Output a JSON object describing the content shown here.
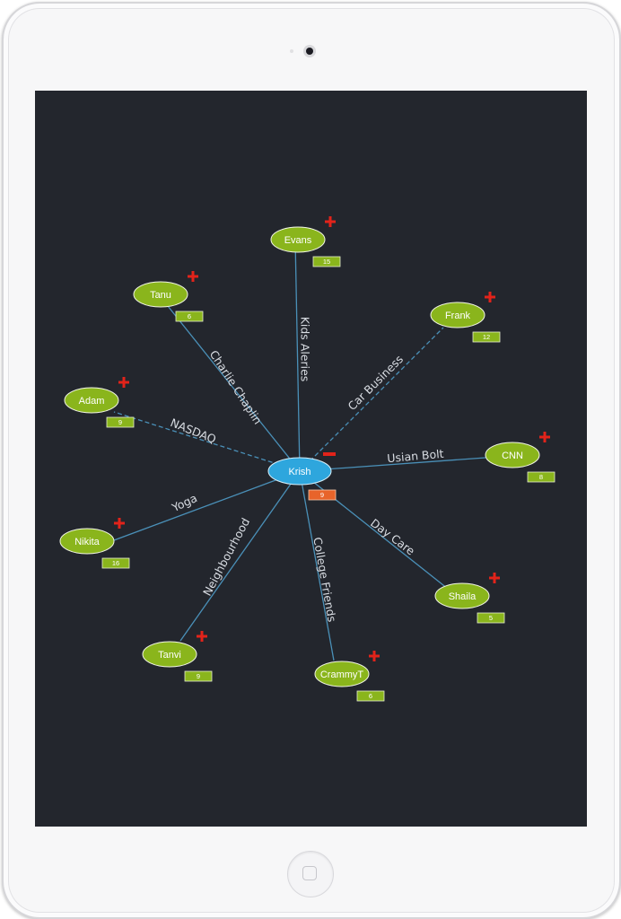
{
  "colors": {
    "background": "#23262d",
    "leaf_node": "#8ab51c",
    "center_node": "#2ea6dd",
    "edge": "#4a90b8",
    "badge": "#8ab51c",
    "center_badge": "#e8642a",
    "expand_icon": "#e2231a"
  },
  "graph": {
    "center": {
      "name": "Krish",
      "count": "9",
      "icon": "minus-icon"
    },
    "nodes": [
      {
        "name": "Evans",
        "count": "15",
        "edge_label": "Kids Aleries",
        "edge_style": "solid",
        "icon": "plus-icon"
      },
      {
        "name": "Tanu",
        "count": "6",
        "edge_label": "Charlie Chaplin",
        "edge_style": "solid",
        "icon": "plus-icon"
      },
      {
        "name": "Frank",
        "count": "12",
        "edge_label": "Car Business",
        "edge_style": "dashed",
        "icon": "plus-icon"
      },
      {
        "name": "Adam",
        "count": "9",
        "edge_label": "NASDAQ",
        "edge_style": "dashed",
        "icon": "plus-icon"
      },
      {
        "name": "CNN",
        "count": "8",
        "edge_label": "Usian Bolt",
        "edge_style": "solid",
        "icon": "plus-icon"
      },
      {
        "name": "Nikita",
        "count": "16",
        "edge_label": "Yoga",
        "edge_style": "solid",
        "icon": "plus-icon"
      },
      {
        "name": "Shaila",
        "count": "5",
        "edge_label": "Day Care",
        "edge_style": "solid",
        "icon": "plus-icon"
      },
      {
        "name": "Tanvi",
        "count": "9",
        "edge_label": "Neighbourhood",
        "edge_style": "solid",
        "icon": "plus-icon"
      },
      {
        "name": "CrammyT",
        "count": "6",
        "edge_label": "College Friends",
        "edge_style": "solid",
        "icon": "plus-icon"
      }
    ]
  }
}
